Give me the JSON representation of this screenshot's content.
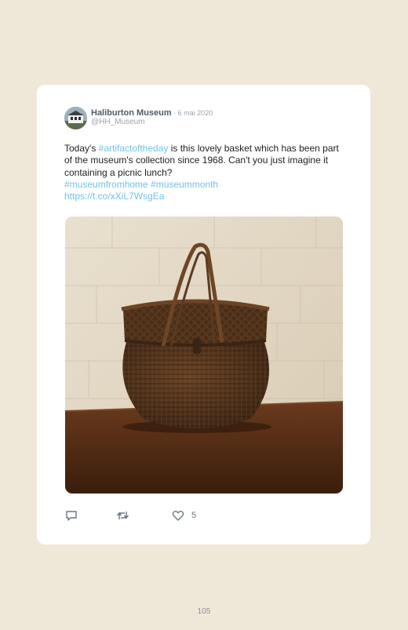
{
  "tweet": {
    "author_name": "Haliburton Museum",
    "date": " · 6 mai 2020",
    "handle": "@HH_Museum",
    "text_1": "Today's ",
    "hashtag_1": "#artifactoftheday",
    "text_2": " is this lovely basket which has been part of the museum's collection since 1968. Can't you just imagine it containing a picnic lunch?",
    "hashtag_2": "#museumfromhome",
    "hashtag_3": "#museummonth",
    "link": "https://t.co/xXiL7WsgEa",
    "likes": "5"
  },
  "icons": {
    "avatar": "museum-building-avatar",
    "reply": "speech-bubble-icon",
    "retweet": "retweet-arrows-icon",
    "like": "heart-icon"
  },
  "colors": {
    "page_background": "#efe8d8",
    "card_background": "#ffffff",
    "link": "#6fc3e8",
    "icon": "#6b7681"
  },
  "page_number": "105"
}
